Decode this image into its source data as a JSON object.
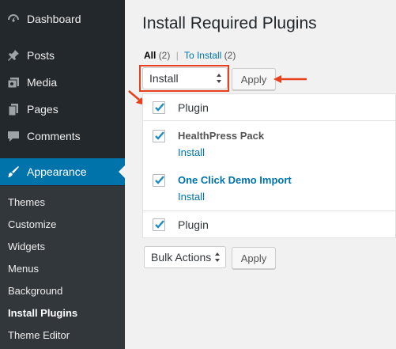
{
  "sidebar": {
    "items": [
      {
        "label": "Dashboard",
        "icon": "dashboard-icon"
      },
      {
        "label": "Posts",
        "icon": "pushpin-icon"
      },
      {
        "label": "Media",
        "icon": "media-icon"
      },
      {
        "label": "Pages",
        "icon": "pages-icon"
      },
      {
        "label": "Comments",
        "icon": "comment-bubble-icon"
      },
      {
        "label": "Appearance",
        "icon": "paintbrush-icon"
      }
    ],
    "submenu": [
      "Themes",
      "Customize",
      "Widgets",
      "Menus",
      "Background",
      "Install Plugins",
      "Theme Editor"
    ]
  },
  "page": {
    "title": "Install Required Plugins",
    "filters": {
      "all_label": "All",
      "all_count": "(2)",
      "separator": "|",
      "to_install_label": "To Install",
      "to_install_count": "(2)"
    },
    "bulk_top": {
      "selected": "Install",
      "apply": "Apply"
    },
    "bulk_bottom": {
      "selected": "Bulk Actions",
      "apply": "Apply"
    },
    "table": {
      "header": "Plugin",
      "footer": "Plugin",
      "rows": [
        {
          "name": "HealthPress Pack",
          "action": "Install"
        },
        {
          "name": "One Click Demo Import",
          "action": "Install"
        }
      ]
    }
  },
  "colors": {
    "sidebar_bg": "#23282d",
    "submenu_bg": "#32373c",
    "accent": "#0073aa",
    "annotation_red": "#e8401c"
  }
}
